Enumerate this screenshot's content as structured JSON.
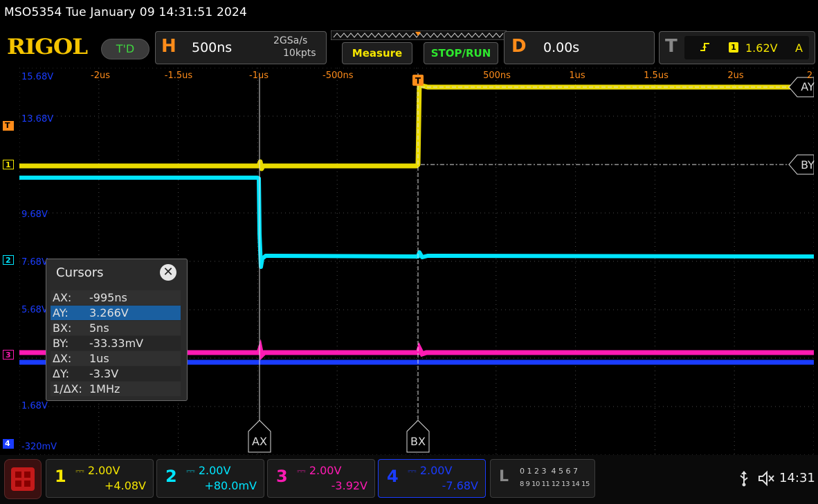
{
  "title_bar": {
    "text": "MSO5354  Tue January 09 14:31:51 2024"
  },
  "brand": {
    "logo": "RIGOL",
    "mode_button": "T'D"
  },
  "horizontal": {
    "letter": "H",
    "timebase": "500ns",
    "sample_rate": "2GSa/s",
    "memory_depth": "10kpts"
  },
  "buttons": {
    "measure": "Measure",
    "stop_run": "STOP/RUN"
  },
  "delay": {
    "letter": "D",
    "value": "0.00s"
  },
  "trigger": {
    "letter": "T",
    "channel": "1",
    "level": "1.62V",
    "mode": "A"
  },
  "time_axis_labels": [
    "-2us",
    "-1.5us",
    "-1us",
    "-500ns",
    "500ns",
    "1us",
    "1.5us",
    "2us",
    "2"
  ],
  "volt_axis_labels": [
    "15.68V",
    "13.68V",
    "9.68V",
    "7.68V",
    "5.68V",
    "1.68V",
    "-320mV"
  ],
  "channel_markers": {
    "trigger": "T",
    "ch1": "1",
    "ch2": "2",
    "ch3": "3",
    "ch4": "4"
  },
  "cursor_tags": {
    "ay": "AY",
    "by": "BY",
    "ax": "AX",
    "bx": "BX"
  },
  "cursors_panel": {
    "title": "Cursors",
    "close": "✕",
    "rows": [
      {
        "key": "AX:",
        "value": "-995ns"
      },
      {
        "key": "AY:",
        "value": "3.266V"
      },
      {
        "key": "BX:",
        "value": "5ns"
      },
      {
        "key": "BY:",
        "value": "-33.33mV"
      },
      {
        "key": "ΔX:",
        "value": "1us"
      },
      {
        "key": "ΔY:",
        "value": "-3.3V"
      },
      {
        "key": "1/ΔX:",
        "value": "1MHz"
      }
    ],
    "selected_row": 1
  },
  "channels": [
    {
      "num": "1",
      "scale": "2.00V",
      "offset": "+4.08V",
      "color": "#f5e600"
    },
    {
      "num": "2",
      "scale": "2.00V",
      "offset": "+80.0mV",
      "color": "#00e5ff"
    },
    {
      "num": "3",
      "scale": "2.00V",
      "offset": "-3.92V",
      "color": "#ff1ab3"
    },
    {
      "num": "4",
      "scale": "2.00V",
      "offset": "-7.68V",
      "color": "#1a3cff"
    }
  ],
  "logic": {
    "letter": "L",
    "row1": "0 1 2 3  4 5 6 7",
    "row2": "8 9 10 11 12 13 14 15"
  },
  "status": {
    "time": "14:31",
    "usb_icon": "usb-icon",
    "speaker_icon": "speaker-muted-icon"
  },
  "colors": {
    "ch1": "#f5e600",
    "ch2": "#00e5ff",
    "ch3": "#ff1ab3",
    "ch4": "#1a3cff",
    "trigger": "#ff8c1a",
    "selected_row": "#1a5fa0"
  }
}
